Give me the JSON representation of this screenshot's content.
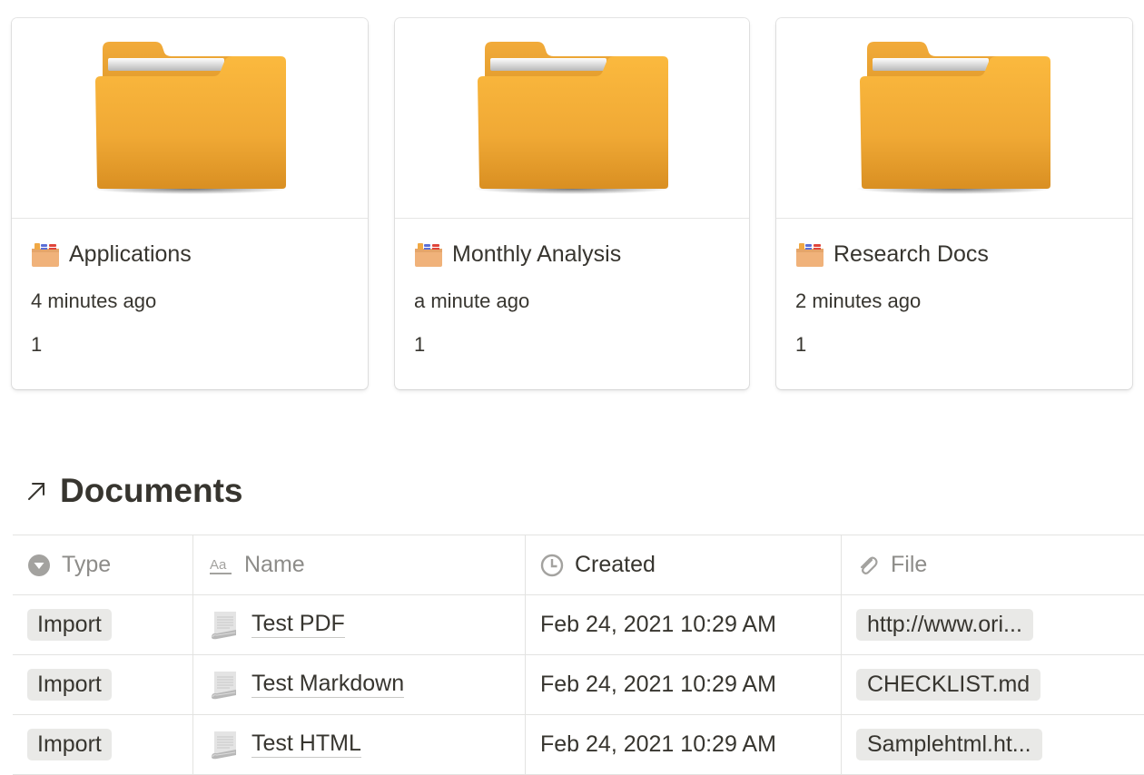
{
  "gallery": {
    "cards": [
      {
        "title": "Applications",
        "icon": "card-index-box-icon",
        "time": "4 minutes ago",
        "count": "1"
      },
      {
        "title": "Monthly Analysis",
        "icon": "card-index-box-icon",
        "time": "a minute ago",
        "count": "1"
      },
      {
        "title": "Research Docs",
        "icon": "card-index-box-icon",
        "time": "2 minutes ago",
        "count": "1"
      }
    ]
  },
  "documents": {
    "title": "Documents",
    "link_icon": "arrow-up-right-icon",
    "columns": [
      {
        "label": "Type",
        "icon": "select-icon"
      },
      {
        "label": "Name",
        "icon": "text-icon"
      },
      {
        "label": "Created",
        "icon": "clock-icon"
      },
      {
        "label": "File",
        "icon": "paperclip-icon"
      }
    ],
    "rows": [
      {
        "type": "Import",
        "name": "Test PDF",
        "created": "Feb 24, 2021 10:29 AM",
        "file": "http://www.ori..."
      },
      {
        "type": "Import",
        "name": "Test Markdown",
        "created": "Feb 24, 2021 10:29 AM",
        "file": "CHECKLIST.md"
      },
      {
        "type": "Import",
        "name": "Test HTML",
        "created": "Feb 24, 2021 10:29 AM",
        "file": "Samplehtml.ht..."
      }
    ]
  },
  "colors": {
    "text": "#37352f",
    "muted": "#8d8c89",
    "tag_bg": "#e9e9e7",
    "folder": "#f5ae3a"
  }
}
